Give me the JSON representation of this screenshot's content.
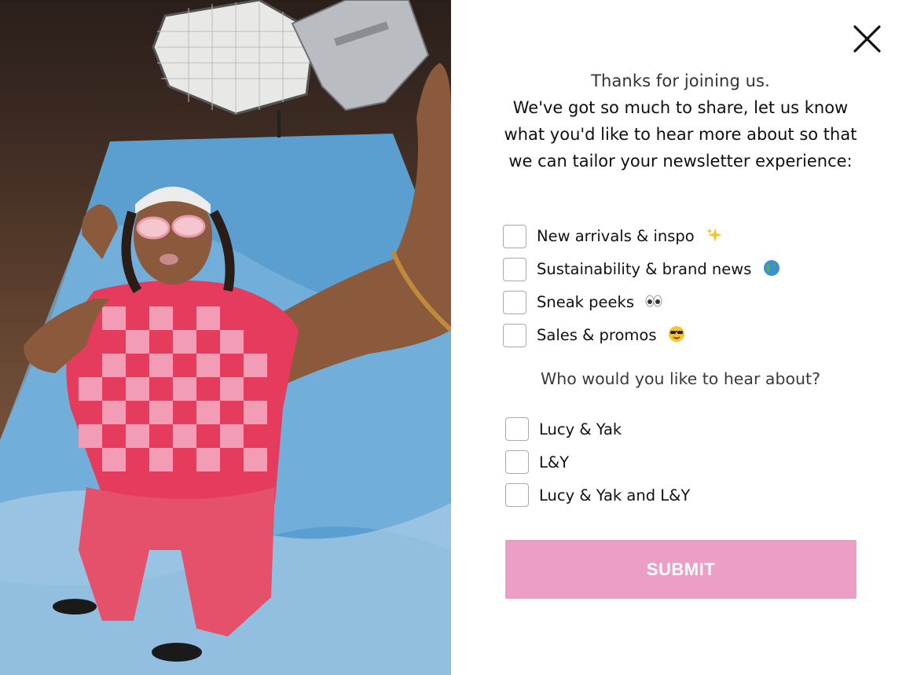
{
  "modal": {
    "close_icon": "close-icon",
    "intro_title": "Thanks for joining us.",
    "intro_body": "We've got so much to share, let us know what you'd like to hear more about so that we can tailor your newsletter experience:",
    "topics": [
      {
        "label": "New arrivals & inspo",
        "emoji": "sparkles-icon",
        "checked": false
      },
      {
        "label": "Sustainability & brand news",
        "emoji": "globe-icon",
        "checked": false
      },
      {
        "label": "Sneak peeks",
        "emoji": "eyes-icon",
        "checked": false
      },
      {
        "label": "Sales & promos",
        "emoji": "sunglasses-face-icon",
        "checked": false
      }
    ],
    "brand_question": "Who would you like to hear about?",
    "brands": [
      {
        "label": "Lucy & Yak",
        "checked": false
      },
      {
        "label": "L&Y",
        "checked": false
      },
      {
        "label": "Lucy & Yak and L&Y",
        "checked": false
      }
    ],
    "submit_label": "SUBMIT"
  },
  "colors": {
    "submit_bg": "#ec9ec7",
    "checkbox_border": "#a9a9a9",
    "text": "#111111"
  }
}
